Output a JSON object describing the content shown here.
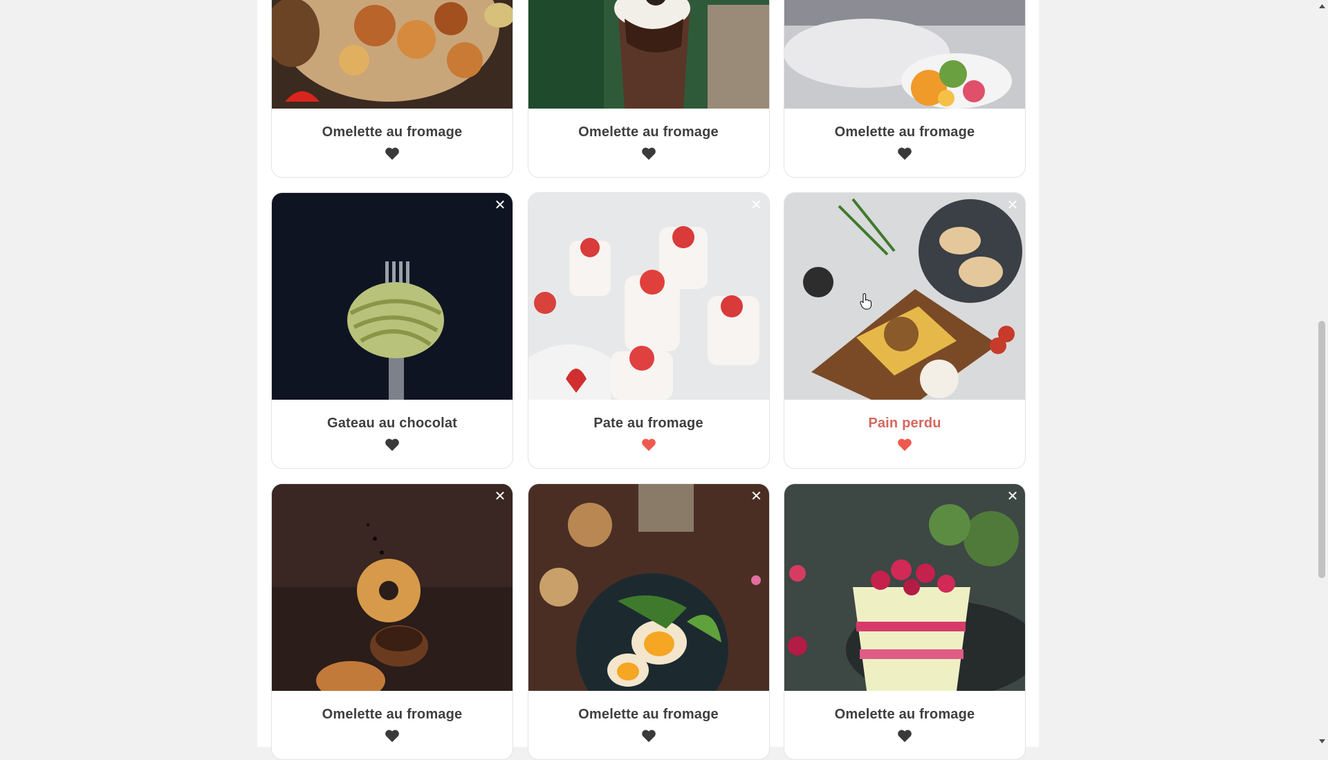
{
  "cards": [
    {
      "title": "Omelette au fromage",
      "favorite": false,
      "close_icon": "close-icon",
      "heart_icon": "heart-icon",
      "image": "grilled-meat-vegetables"
    },
    {
      "title": "Omelette au fromage",
      "favorite": false,
      "close_icon": "close-icon",
      "heart_icon": "heart-icon",
      "image": "chocolate-sundae"
    },
    {
      "title": "Omelette au fromage",
      "favorite": false,
      "close_icon": "close-icon",
      "heart_icon": "heart-icon",
      "image": "fruit-salad-plate"
    },
    {
      "title": "Gateau au chocolat",
      "favorite": false,
      "close_icon": "close-icon",
      "heart_icon": "heart-icon",
      "image": "pasta-on-fork"
    },
    {
      "title": "Pate au fromage",
      "favorite": true,
      "close_icon": "close-icon",
      "heart_icon": "heart-icon",
      "image": "strawberry-panna-cotta"
    },
    {
      "title": "Pain perdu",
      "favorite": true,
      "close_icon": "close-icon",
      "heart_icon": "heart-icon",
      "image": "nachos-board"
    },
    {
      "title": "Omelette au fromage",
      "favorite": false,
      "close_icon": "close-icon",
      "heart_icon": "heart-icon",
      "image": "falling-donuts"
    },
    {
      "title": "Omelette au fromage",
      "favorite": false,
      "close_icon": "close-icon",
      "heart_icon": "heart-icon",
      "image": "egg-avocado-toast"
    },
    {
      "title": "Omelette au fromage",
      "favorite": false,
      "close_icon": "close-icon",
      "heart_icon": "heart-icon",
      "image": "raspberry-cake-slice"
    }
  ],
  "colors": {
    "heart_default": "#3a3a3a",
    "heart_favorite": "#ee5a4f",
    "title_default": "#3f3f3f",
    "title_hover": "#d4675d"
  }
}
